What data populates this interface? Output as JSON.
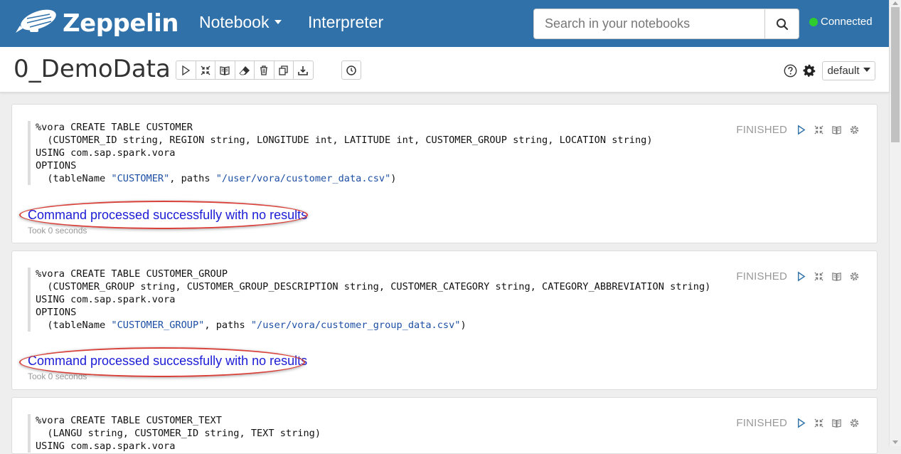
{
  "navbar": {
    "brand": "Zeppelin",
    "notebook_label": "Notebook",
    "interpreter_label": "Interpreter",
    "search_placeholder": "Search in your notebooks",
    "status_label": "Connected",
    "status_color": "#2fcc2f",
    "bg_color": "#3071a9"
  },
  "header": {
    "title": "0_DemoData",
    "toolbar_icons": [
      "play-icon",
      "collapse-icon",
      "book-icon",
      "eraser-icon",
      "trash-icon",
      "copy-icon",
      "download-icon"
    ],
    "schedule_icon": "clock-icon",
    "interpreter_select": "default"
  },
  "paragraphs": [
    {
      "code": [
        {
          "text": "%vora CREATE TABLE CUSTOMER"
        },
        {
          "text": "  (CUSTOMER_ID string, REGION string, LONGITUDE int, LATITUDE int, CUSTOMER_GROUP string, LOCATION string)"
        },
        {
          "text": "USING com.sap.spark.vora"
        },
        {
          "text": "OPTIONS"
        },
        {
          "pre": "  (tableName ",
          "s1": "\"CUSTOMER\"",
          "mid": ", paths ",
          "s2": "\"/user/vora/customer_data.csv\"",
          "post": ")"
        }
      ],
      "status": "FINISHED",
      "result": "Command processed successfully with no results",
      "took": "Took 0 seconds"
    },
    {
      "code": [
        {
          "text": "%vora CREATE TABLE CUSTOMER_GROUP"
        },
        {
          "text": "  (CUSTOMER_GROUP string, CUSTOMER_GROUP_DESCRIPTION string, CUSTOMER_CATEGORY string, CATEGORY_ABBREVIATION string)"
        },
        {
          "text": "USING com.sap.spark.vora"
        },
        {
          "text": "OPTIONS"
        },
        {
          "pre": "  (tableName ",
          "s1": "\"CUSTOMER_GROUP\"",
          "mid": ", paths ",
          "s2": "\"/user/vora/customer_group_data.csv\"",
          "post": ")"
        }
      ],
      "status": "FINISHED",
      "result": "Command processed successfully with no results",
      "took": "Took 0 seconds"
    },
    {
      "code": [
        {
          "text": "%vora CREATE TABLE CUSTOMER_TEXT"
        },
        {
          "text": "  (LANGU string, CUSTOMER_ID string, TEXT string)"
        },
        {
          "text": "USING com.sap.spark.vora"
        }
      ],
      "status": "FINISHED"
    }
  ]
}
